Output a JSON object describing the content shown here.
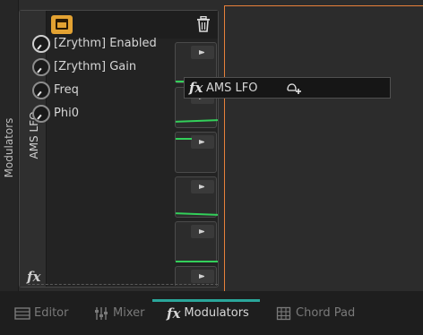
{
  "sidebar_tab": {
    "label": "Modulators"
  },
  "modulator": {
    "title": "AMS LFO",
    "fx_glyph": "fx",
    "params": [
      {
        "label": "[Zrythm] Enabled",
        "knob": "enabled"
      },
      {
        "label": "[Zrythm] Gain",
        "knob": "gain"
      },
      {
        "label": "Freq",
        "knob": "freq"
      },
      {
        "label": "Phi0",
        "knob": "phi0"
      }
    ]
  },
  "drag": {
    "fx_glyph": "fx",
    "label": "AMS LFO"
  },
  "bottom_tabs": [
    {
      "label": "Editor",
      "icon": "editor-icon"
    },
    {
      "label": "Mixer",
      "icon": "mixer-icon"
    },
    {
      "label": "Modulators",
      "icon": "fx-icon"
    },
    {
      "label": "Chord Pad",
      "icon": "grid-icon"
    }
  ],
  "colors": {
    "accent": "#e3a232",
    "drop_border": "#e8813a",
    "graph_line": "#33d05a",
    "tab_indicator": "#2aa69a"
  }
}
